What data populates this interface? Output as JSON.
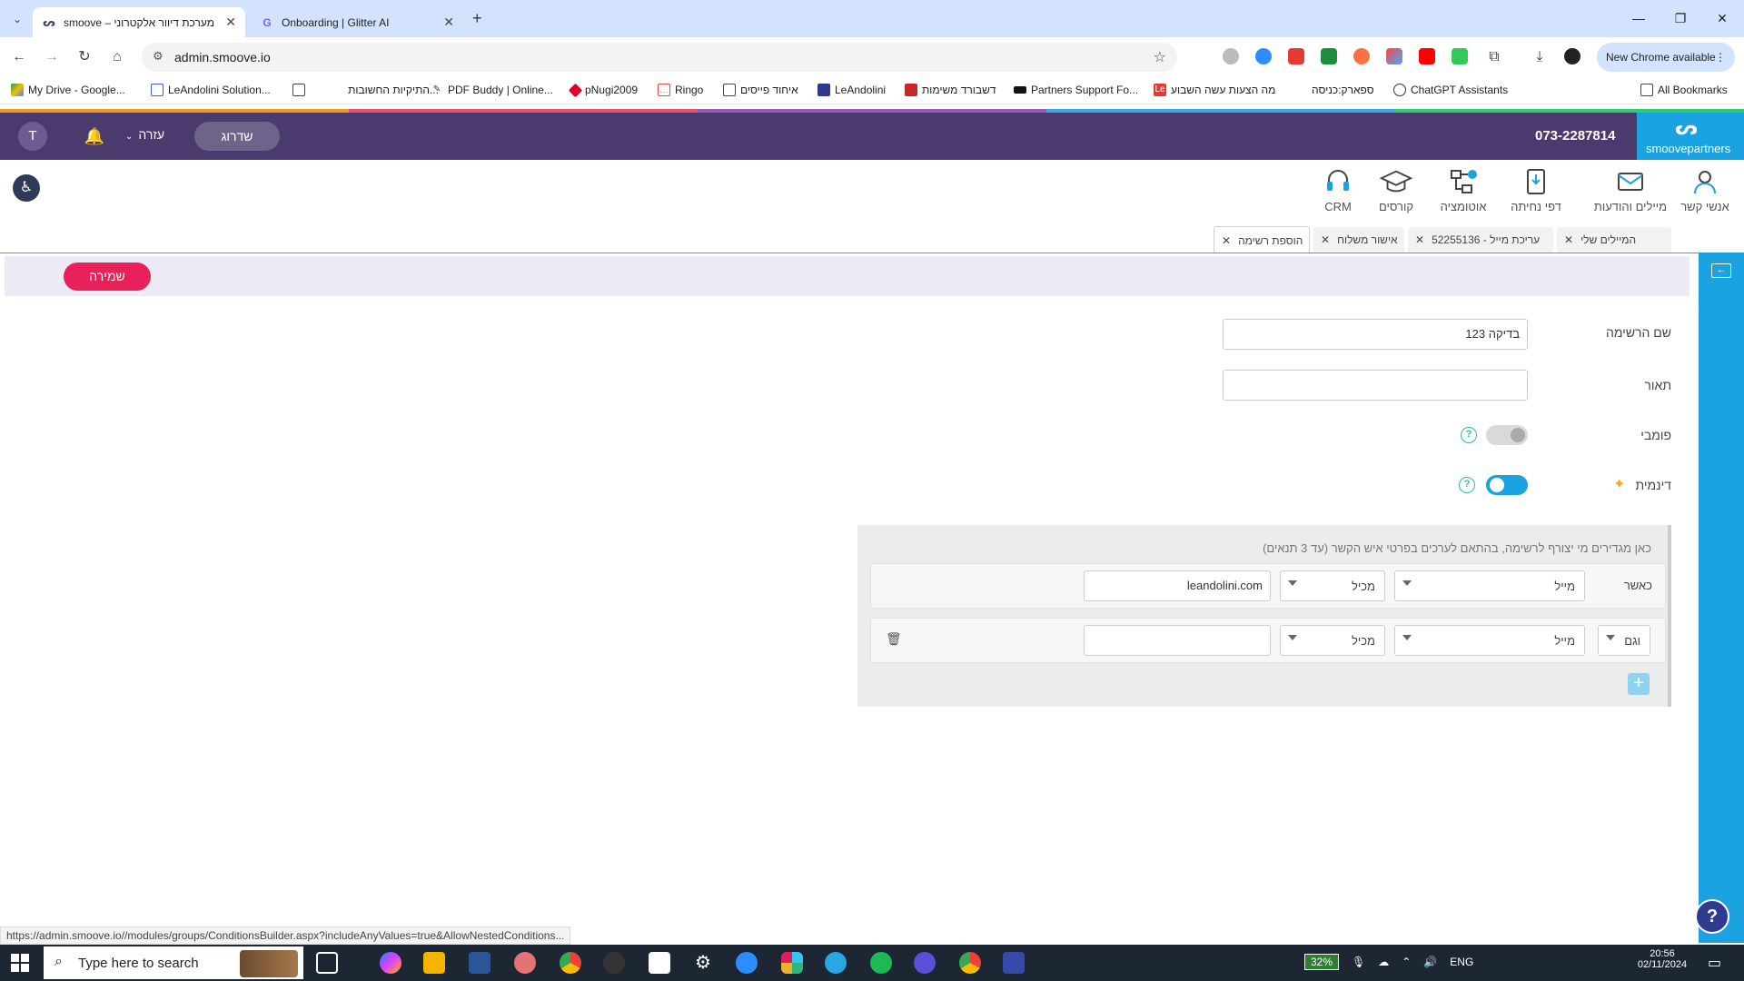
{
  "browser": {
    "tabs": [
      {
        "title": "smoove – מערכת דיוור אלקטרוני",
        "active": true,
        "favicon": "smoove-favicon"
      },
      {
        "title": "Onboarding | Glitter AI",
        "active": false,
        "favicon": "glitter-favicon"
      }
    ],
    "new_tab_label": "+",
    "url": "admin.smoove.io",
    "new_chrome_label": "New Chrome available",
    "bookmarks": [
      "My Drive - Google...",
      "LeAndolini Solution...",
      "התיקיות החשובות...",
      "PDF Buddy | Online...",
      "pNugi2009",
      "Ringo",
      "איחוד פייסים",
      "LeAndolini",
      "דשבורד משימות",
      "Partners Support Fo...",
      "מה הצעות עשה השבוע",
      "ספארק:כניסה",
      "ChatGPT Assistants"
    ],
    "all_bookmarks": "All Bookmarks"
  },
  "header": {
    "avatar_letter": "T",
    "help": "עזרה",
    "upgrade": "שדרוג",
    "phone": "073-2287814",
    "logo": "smoovepartners"
  },
  "modules": [
    {
      "label": "אנשי קשר",
      "icon": "contacts-icon"
    },
    {
      "label": "מיילים והודעות",
      "icon": "emails-icon"
    },
    {
      "label": "דפי נחיתה",
      "icon": "landing-pages-icon"
    },
    {
      "label": "אוטומציה",
      "icon": "automation-icon"
    },
    {
      "label": "קורסים",
      "icon": "courses-icon"
    },
    {
      "label": "CRM",
      "icon": "crm-icon"
    }
  ],
  "worktabs": [
    {
      "label": "המיילים שלי"
    },
    {
      "label": "עריכת מייל - 52255136"
    },
    {
      "label": "אישור משלוח"
    },
    {
      "label": "הוספת רשימה",
      "active": true
    }
  ],
  "save_label": "שמירה",
  "form": {
    "name_label": "שם הרשימה",
    "name_value": "בדיקה 123",
    "desc_label": "תאור",
    "desc_value": "",
    "public_label": "פומבי",
    "dynamic_label": "דינמית",
    "public_enabled": false,
    "dynamic_enabled": true
  },
  "conditions": {
    "hint": "כאן מגדירים מי יצורף לרשימה, בהתאם לערכים בפרטי איש הקשר (עד 3 תנאים)",
    "rows": [
      {
        "prefix": "כאשר",
        "field": "מייל",
        "operator": "מכיל",
        "value": "leandolini.com"
      },
      {
        "prefix": "וגם",
        "field": "מייל",
        "operator": "מכיל",
        "value": ""
      }
    ]
  },
  "status_url": "https://admin.smoove.io//modules/groups/ConditionsBuilder.aspx?includeAnyValues=true&AllowNestedConditions...",
  "taskbar": {
    "search_placeholder": "Type here to search",
    "battery": "32%",
    "lang": "ENG",
    "time": "20:56",
    "date": "02/11/2024"
  }
}
